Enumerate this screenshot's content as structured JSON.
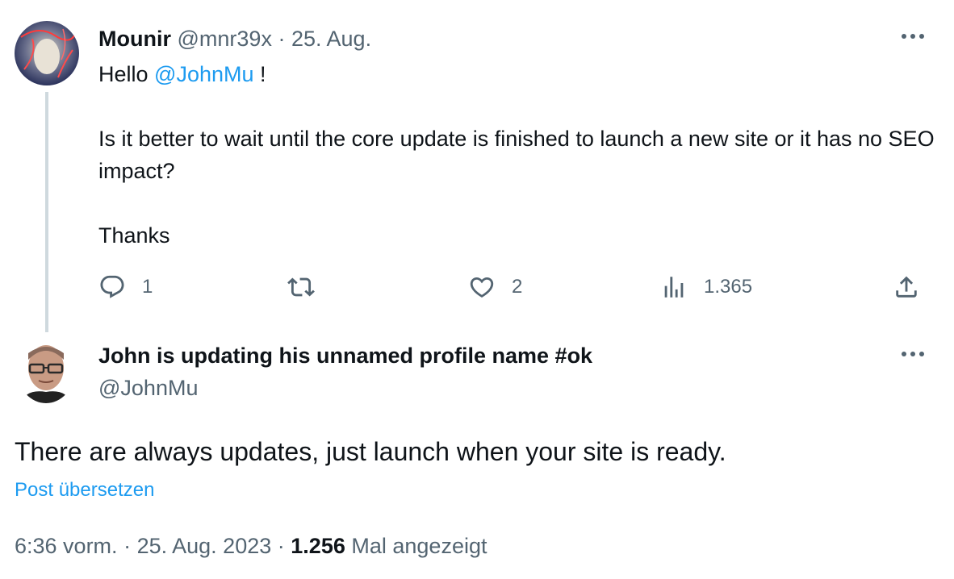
{
  "tweet1": {
    "author_name": "Mounir",
    "handle": "@mnr39x",
    "separator": "·",
    "date": "25. Aug.",
    "body": {
      "greeting_prefix": "Hello ",
      "mention": "@JohnMu",
      "greeting_suffix": " !",
      "question": "Is it better to wait until the core update is finished to launch a new site or it has no SEO impact?",
      "signoff": "Thanks"
    },
    "actions": {
      "replies": "1",
      "reposts": "",
      "likes": "2",
      "views": "1.365"
    }
  },
  "tweet2": {
    "author_name": "John is updating his unnamed profile name #ok",
    "handle": "@JohnMu",
    "body": "There are always updates, just launch when your site is ready.",
    "translate_link": "Post übersetzen",
    "footer": {
      "time": "6:36 vorm.",
      "sep1": "·",
      "date": "25. Aug. 2023",
      "sep2": "·",
      "views_count": "1.256",
      "views_label": "Mal angezeigt"
    }
  },
  "icons": {
    "reply": "reply-icon",
    "repost": "repost-icon",
    "like": "heart-icon",
    "views": "views-icon",
    "share": "share-icon",
    "more": "more-icon"
  },
  "colors": {
    "accent": "#1d9bf0",
    "secondary_text": "#536471",
    "primary_text": "#0f1419",
    "thread_line": "#cfd9de"
  }
}
